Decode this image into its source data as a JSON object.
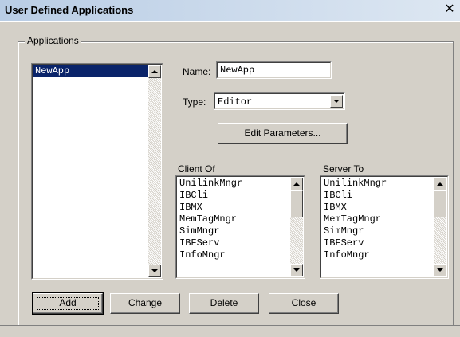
{
  "window": {
    "title": "User Defined Applications",
    "close_glyph": "✕"
  },
  "group": {
    "label": "Applications"
  },
  "applications": {
    "items": [
      "NewApp"
    ],
    "selected_index": 0
  },
  "name_field": {
    "label": "Name:",
    "value": "NewApp"
  },
  "type_field": {
    "label": "Type:",
    "value": "Editor"
  },
  "edit_parameters_button": {
    "label": "Edit Parameters..."
  },
  "client_of": {
    "label": "Client Of",
    "items": [
      "UnilinkMngr",
      "IBCli",
      "IBMX",
      "MemTagMngr",
      "SimMngr",
      "IBFServ",
      "InfoMngr"
    ]
  },
  "server_to": {
    "label": "Server To",
    "items": [
      "UnilinkMngr",
      "IBCli",
      "IBMX",
      "MemTagMngr",
      "SimMngr",
      "IBFServ",
      "InfoMngr"
    ]
  },
  "buttons": {
    "add": "Add",
    "change": "Change",
    "delete": "Delete",
    "close": "Close"
  },
  "colors": {
    "face": "#d4d0c8",
    "selection": "#0a246a",
    "title_start": "#b9cde5",
    "title_end": "#dde7f2"
  }
}
